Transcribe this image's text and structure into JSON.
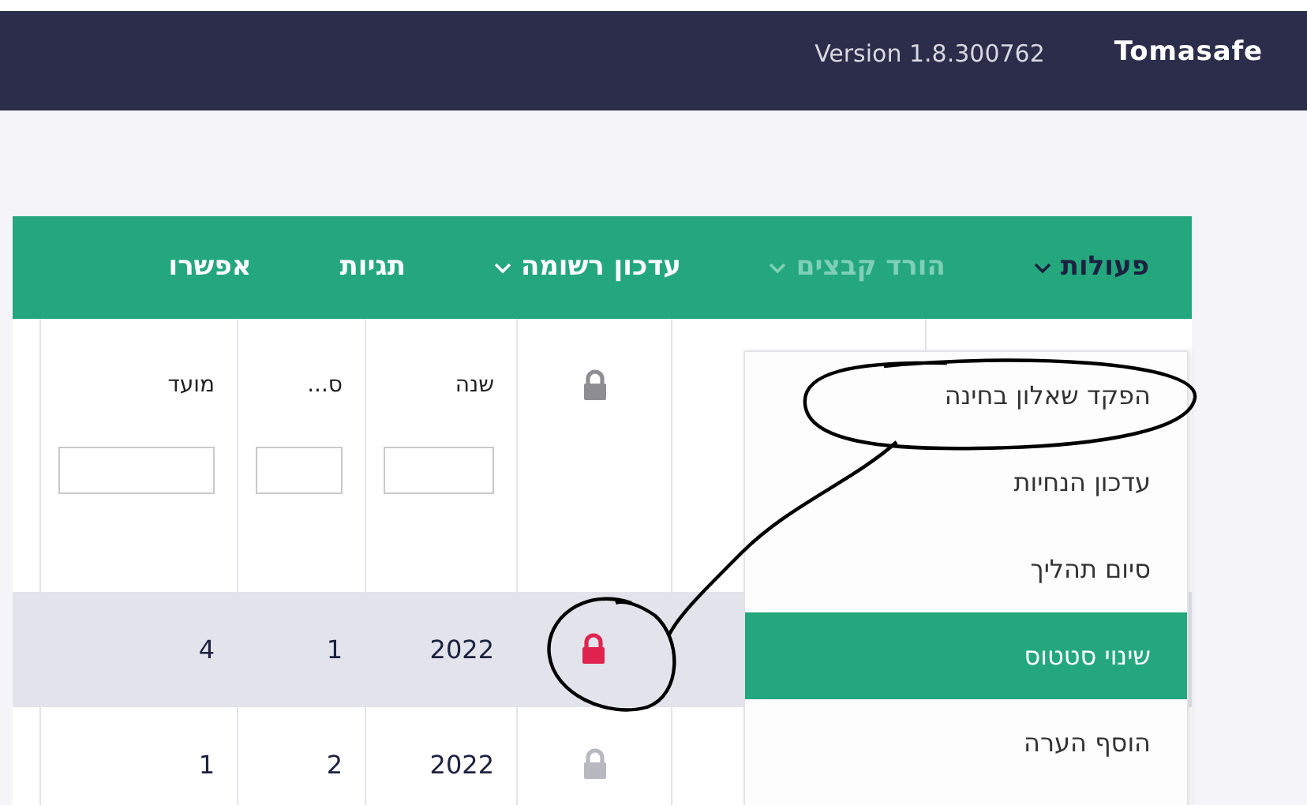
{
  "header": {
    "version": "Version 1.8.300762",
    "brand": "Tomasafe"
  },
  "toolbar": [
    {
      "label": "פעולות",
      "kind": "dropdown",
      "disabled": false
    },
    {
      "label": "הורד קבצים",
      "kind": "dropdown",
      "disabled": true
    },
    {
      "label": "עדכון רשומה",
      "kind": "dropdown",
      "disabled": false
    },
    {
      "label": "תגיות",
      "kind": "plain",
      "disabled": false
    },
    {
      "label": "אפשרו",
      "kind": "plain",
      "disabled": false
    }
  ],
  "table": {
    "columns": [
      {
        "kind": "lock"
      },
      {
        "kind": "text",
        "label": "שנה",
        "filter": true
      },
      {
        "kind": "text",
        "label": "ס...",
        "filter": true
      },
      {
        "kind": "text",
        "label": "מועד",
        "filter": true
      }
    ],
    "rows": [
      {
        "selected": true,
        "locked": true,
        "cells": [
          "",
          "2022",
          "1",
          "4"
        ]
      },
      {
        "selected": false,
        "locked": false,
        "cells": [
          "",
          "2022",
          "2",
          "1"
        ]
      }
    ]
  },
  "menu": {
    "items": [
      {
        "label": "הפקד שאלון בחינה",
        "selected": false
      },
      {
        "label": "עדכון הנחיות",
        "selected": false
      },
      {
        "label": "סיום תהליך",
        "selected": false
      },
      {
        "label": "שינוי סטטוס",
        "selected": true
      },
      {
        "label": "הוסף הערה",
        "selected": false
      }
    ]
  }
}
